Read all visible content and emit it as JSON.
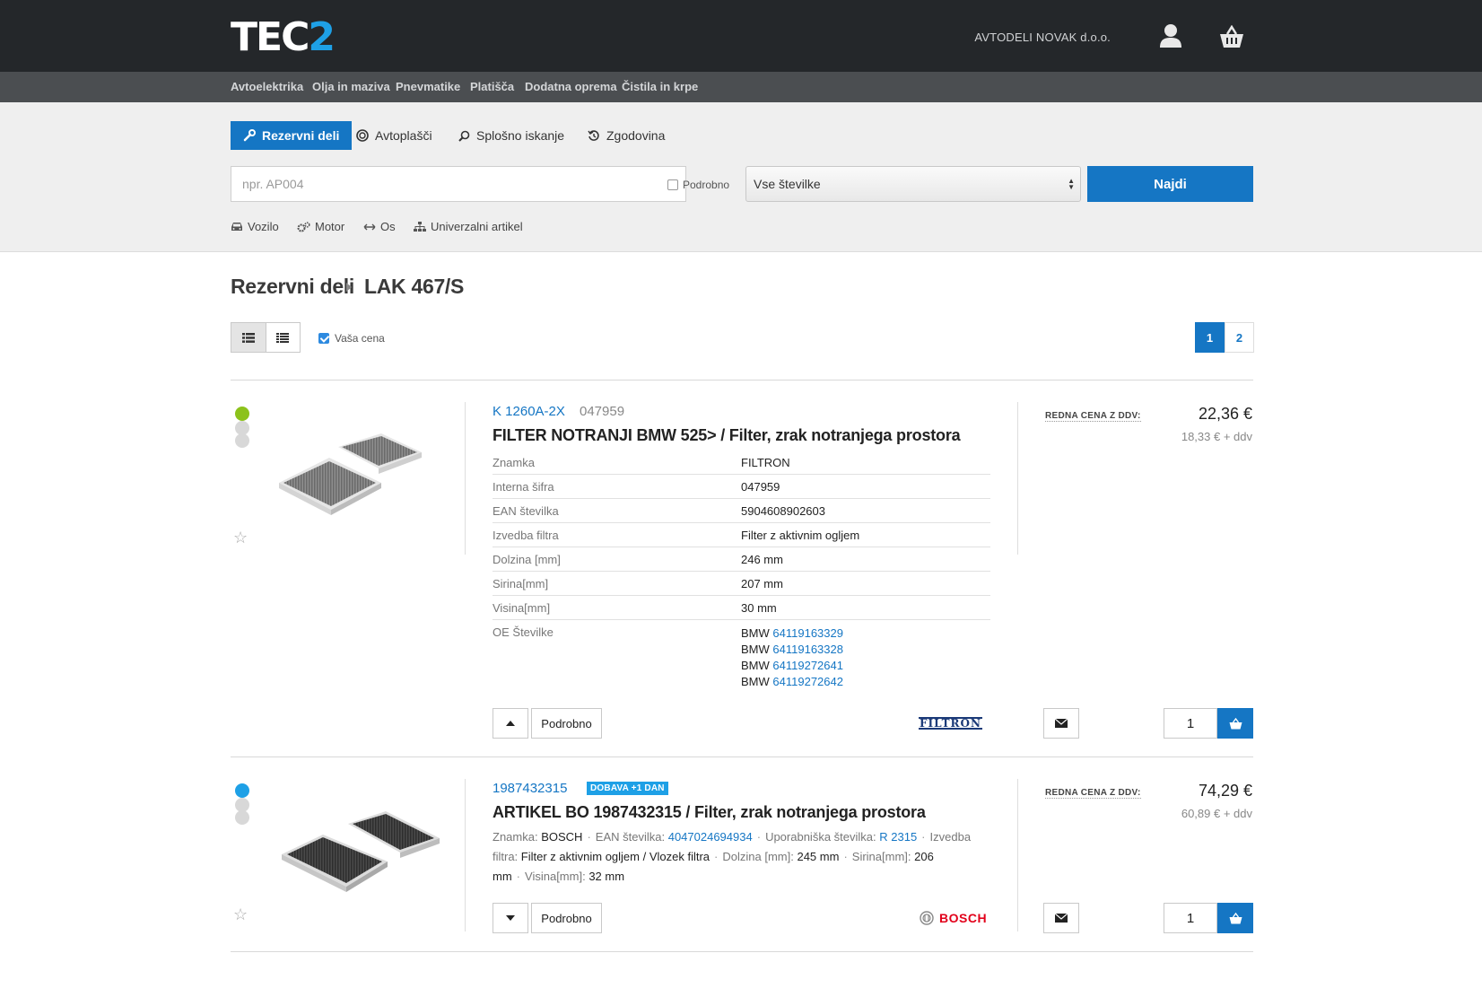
{
  "header": {
    "logo_main": "TEC",
    "logo_accent": "2",
    "company": "AVTODELI NOVAK d.o.o.",
    "icons": [
      "user-icon",
      "cart-icon"
    ]
  },
  "categories": [
    "Avtoelektrika",
    "Olja in maziva",
    "Pnevmatike",
    "Platišča",
    "Dodatna oprema",
    "Čistila in krpe"
  ],
  "search": {
    "tabs": [
      "Rezervni deli",
      "Avtoplašči",
      "Splošno iskanje",
      "Zgodovina"
    ],
    "placeholder": "npr. AP004",
    "podrobno_label": "Podrobno",
    "select_value": "Vse številke",
    "submit_label": "Najdi",
    "subtabs": [
      "Vozilo",
      "Motor",
      "Os",
      "Univerzalni artikel"
    ]
  },
  "breadcrumb": {
    "root": "Rezervni deli",
    "current": "LAK 467/S"
  },
  "listing": {
    "vasa_cena_label": "Vaša cena",
    "pages": [
      "1",
      "2"
    ]
  },
  "products": [
    {
      "status_color": "#8cc21b",
      "code": "K 1260A-2X",
      "internal": "047959",
      "title": "FILTER NOTRANJI BMW 525> / Filter, zrak notranjega prostora",
      "specs": [
        {
          "k": "Znamka",
          "v": "FILTRON"
        },
        {
          "k": "Interna šifra",
          "v": "047959"
        },
        {
          "k": "EAN številka",
          "v": "5904608902603"
        },
        {
          "k": "Izvedba filtra",
          "v": "Filter z aktivnim ogljem"
        },
        {
          "k": "Dolzina [mm]",
          "v": "246 mm"
        },
        {
          "k": "Sirina[mm]",
          "v": "207 mm"
        },
        {
          "k": "Visina[mm]",
          "v": "30 mm"
        }
      ],
      "oe_label": "OE Številke",
      "oe": [
        {
          "make": "BMW",
          "num": "64119163329"
        },
        {
          "make": "BMW",
          "num": "64119163328"
        },
        {
          "make": "BMW",
          "num": "64119272641"
        },
        {
          "make": "BMW",
          "num": "64119272642"
        }
      ],
      "details_label": "Podrobno",
      "brand": "FILTRON",
      "price_label": "REDNA CENA Z DDV:",
      "price": "22,36 €",
      "price_net": "18,33 € + ddv",
      "qty": "1"
    },
    {
      "status_color": "#1ea0e6",
      "code": "1987432315",
      "badge": "DOBAVA +1 DAN",
      "title": "ARTIKEL BO 1987432315 / Filter, zrak notranjega prostora",
      "inline": {
        "znamka_k": "Znamka:",
        "znamka_v": "BOSCH",
        "ean_k": "EAN številka:",
        "ean_v": "4047024694934",
        "up_k": "Uporabniška številka:",
        "up_v": "R 2315",
        "izv_k": "Izvedba filtra:",
        "izv_v": "Filter z aktivnim ogljem / Vlozek filtra",
        "dol_k": "Dolzina [mm]:",
        "dol_v": "245 mm",
        "sir_k": "Sirina[mm]:",
        "sir_v": "206 mm",
        "vis_k": "Visina[mm]:",
        "vis_v": "32 mm"
      },
      "details_label": "Podrobno",
      "brand": "BOSCH",
      "price_label": "REDNA CENA Z DDV:",
      "price": "74,29 €",
      "price_net": "60,89 € + ddv",
      "qty": "1"
    }
  ]
}
